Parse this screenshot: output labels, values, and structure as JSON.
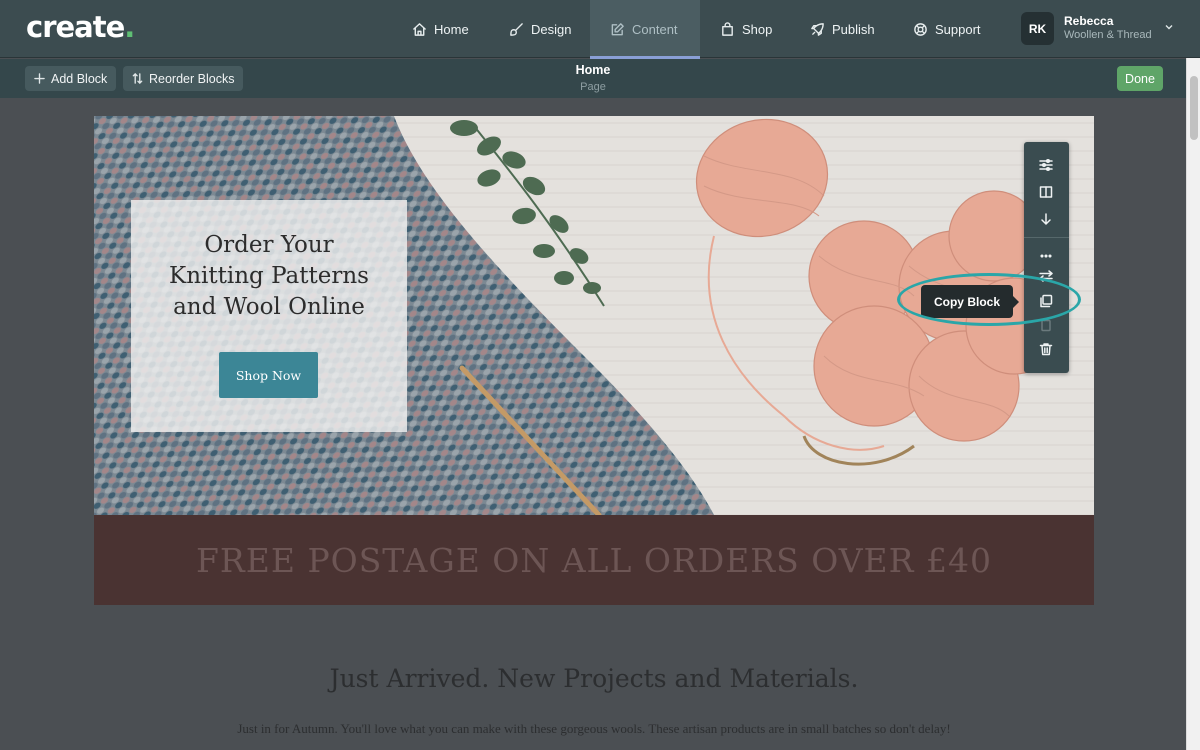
{
  "brand": {
    "logo_text": "create",
    "logo_dot": "."
  },
  "nav": {
    "items": [
      {
        "label": "Home",
        "icon": "home-icon",
        "active": false
      },
      {
        "label": "Design",
        "icon": "brush-icon",
        "active": false
      },
      {
        "label": "Content",
        "icon": "edit-icon",
        "active": true
      },
      {
        "label": "Shop",
        "icon": "bag-icon",
        "active": false
      },
      {
        "label": "Publish",
        "icon": "rocket-icon",
        "active": false
      },
      {
        "label": "Support",
        "icon": "lifebuoy-icon",
        "active": false
      }
    ],
    "user": {
      "initials": "RK",
      "name": "Rebecca",
      "site": "Woollen & Thread"
    }
  },
  "toolbar": {
    "add_block_label": "Add Block",
    "reorder_label": "Reorder Blocks",
    "page_title": "Home",
    "page_subtitle": "Page",
    "done_label": "Done"
  },
  "hero": {
    "heading": "Order Your\nKnitting Patterns\nand Wool Online",
    "button_label": "Shop Now"
  },
  "block_tools": {
    "buttons": [
      "sliders-icon",
      "columns-icon",
      "arrow-down-icon",
      "more-icon",
      "swap-icon",
      "copy-icon",
      "paste-icon",
      "trash-icon"
    ],
    "tooltip": "Copy Block"
  },
  "banner": {
    "text": "FREE POSTAGE ON ALL ORDERS OVER £40"
  },
  "section": {
    "title": "Just Arrived. New Projects and Materials.",
    "description": "Just in for Autumn. You'll love what you can make with these gorgeous wools. These artisan products are in small batches so don't delay!"
  },
  "colors": {
    "nav_bg": "#3c4c50",
    "toolbar_bg": "#34474b",
    "accent_green": "#5fa568",
    "hero_button": "#3c8696",
    "banner_bg": "#4a3332",
    "highlight_ring": "#2aa6a8",
    "overlay": "#4b4f53"
  }
}
